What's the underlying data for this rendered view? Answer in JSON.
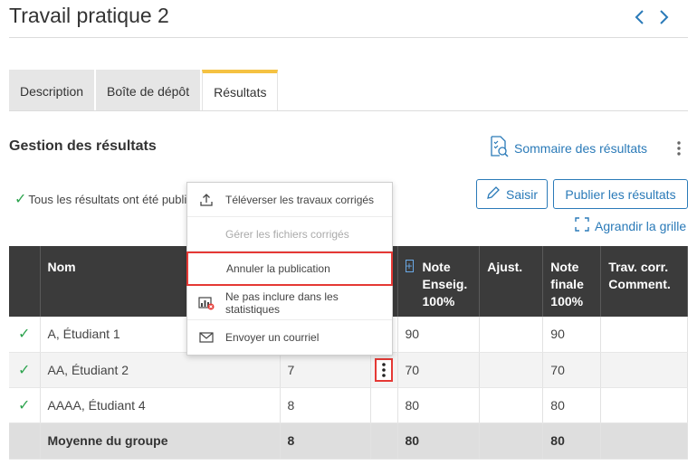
{
  "header": {
    "title": "Travail pratique 2"
  },
  "tabs": [
    {
      "label": "Description"
    },
    {
      "label": "Boîte de dépôt"
    },
    {
      "label": "Résultats"
    }
  ],
  "section": {
    "title": "Gestion des résultats",
    "summary_link": "Sommaire des résultats"
  },
  "status": {
    "text": "Tous les résultats ont été publié"
  },
  "buttons": {
    "saisir": "Saisir",
    "publier": "Publier les résultats",
    "enlarge": "Agrandir la grille"
  },
  "menu": {
    "items": [
      {
        "label": "Téléverser les travaux corrigés",
        "icon": "upload-icon"
      },
      {
        "label": "Gérer les fichiers corrigés",
        "icon": ""
      },
      {
        "label": "Annuler la publication",
        "icon": ""
      },
      {
        "label": "Ne pas inclure dans les statistiques",
        "icon": "stats-excluded-icon"
      },
      {
        "label": "Envoyer un courriel",
        "icon": "email-icon"
      }
    ]
  },
  "table": {
    "headers": {
      "name": "Nom",
      "note": "Note Enseig. 100%",
      "ajust": "Ajust.",
      "final": "Note finale 100%",
      "comments": "Trav. corr. Comment."
    },
    "rows": [
      {
        "name": "A, Étudiant 1",
        "raw": "",
        "note": "90",
        "ajust": "",
        "final": "90"
      },
      {
        "name": "AA, Étudiant 2",
        "raw": "7",
        "note": "70",
        "ajust": "",
        "final": "70"
      },
      {
        "name": "AAAA, Étudiant 4",
        "raw": "8",
        "note": "80",
        "ajust": "",
        "final": "80"
      }
    ],
    "footer": {
      "label": "Moyenne du groupe",
      "raw": "8",
      "note": "80",
      "final": "80"
    }
  },
  "colors": {
    "accent": "#2a7ab8",
    "tab_active": "#f5c242",
    "highlight": "#e53935",
    "check": "#2ea44f"
  }
}
